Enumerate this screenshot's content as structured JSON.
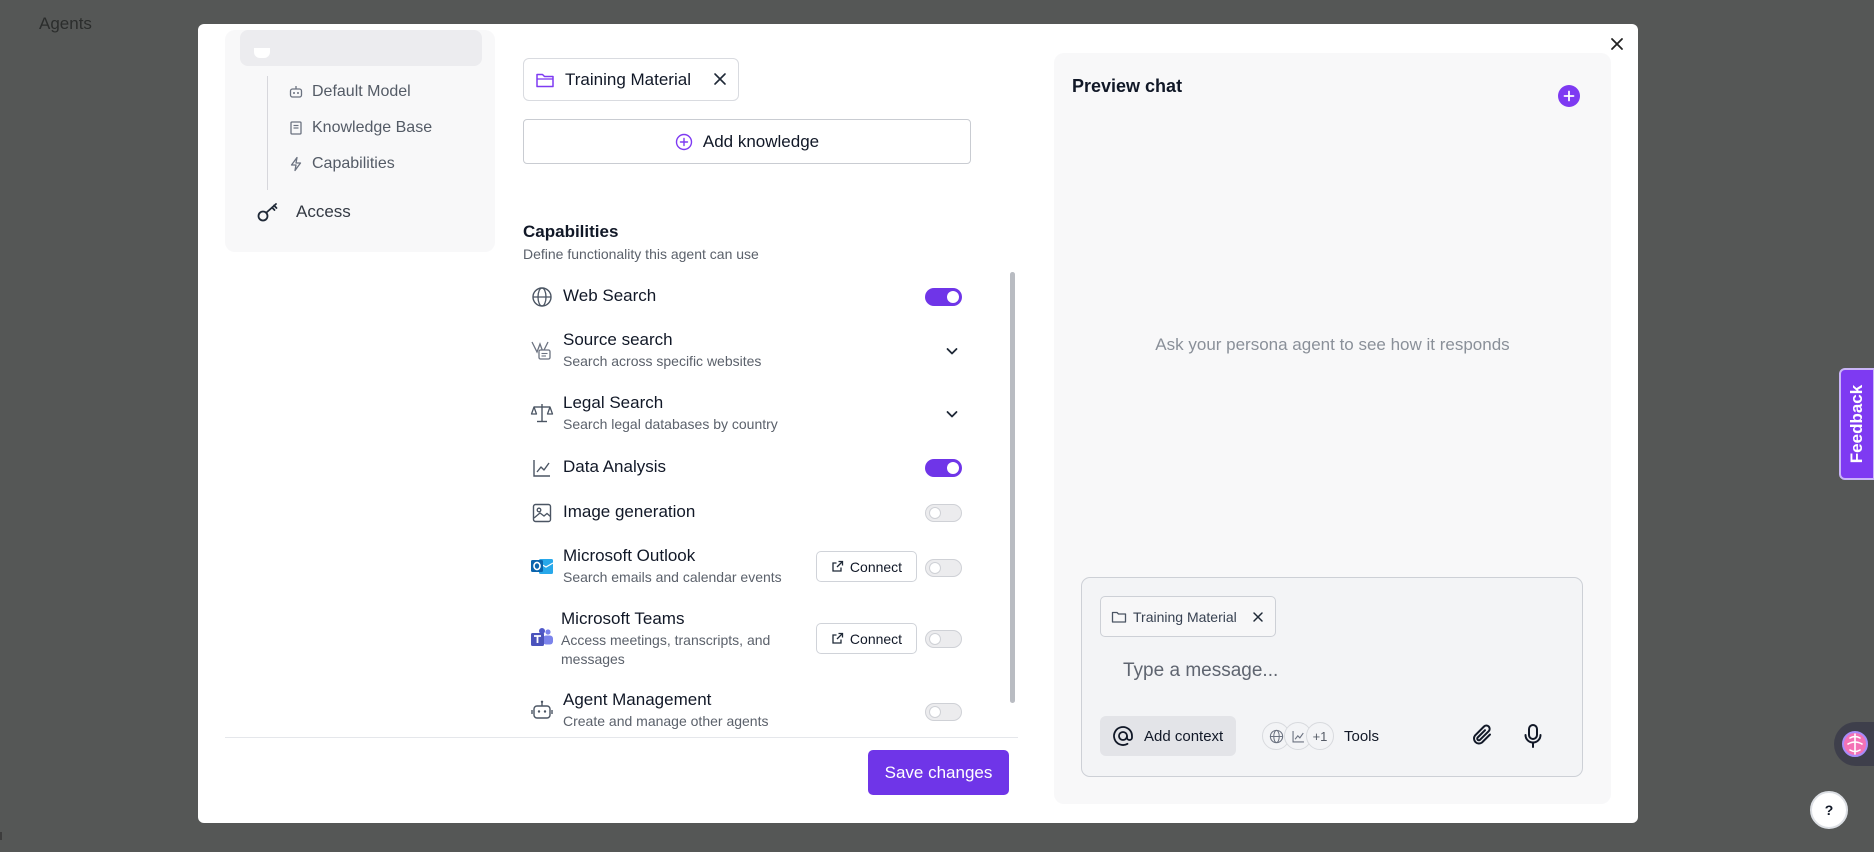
{
  "background": {
    "page_title": "Agents"
  },
  "nav": {
    "sub_items": [
      {
        "label": "Default Model",
        "icon": "bot-icon"
      },
      {
        "label": "Knowledge Base",
        "icon": "book-icon"
      },
      {
        "label": "Capabilities",
        "icon": "bolt-icon"
      }
    ],
    "access_label": "Access",
    "access_icon": "key-icon"
  },
  "knowledge": {
    "chip_label": "Training Material",
    "add_button_label": "Add knowledge"
  },
  "capabilities": {
    "title": "Capabilities",
    "description": "Define functionality this agent can use",
    "items": [
      {
        "name": "Web Search",
        "subtitle": "",
        "icon": "globe-icon",
        "control": "toggle",
        "enabled": true
      },
      {
        "name": "Source search",
        "subtitle": "Search across specific websites",
        "icon": "source-search-icon",
        "control": "expand",
        "enabled": false
      },
      {
        "name": "Legal Search",
        "subtitle": "Search legal databases by country",
        "icon": "scales-icon",
        "control": "expand",
        "enabled": false
      },
      {
        "name": "Data Analysis",
        "subtitle": "",
        "icon": "chart-line-icon",
        "control": "toggle",
        "enabled": true
      },
      {
        "name": "Image generation",
        "subtitle": "",
        "icon": "image-icon",
        "control": "toggle",
        "enabled": false
      },
      {
        "name": "Microsoft Outlook",
        "subtitle": "Search emails and calendar events",
        "icon": "outlook-icon",
        "control": "connect",
        "enabled": false
      },
      {
        "name": "Microsoft Teams",
        "subtitle": "Access meetings, transcripts, and messages",
        "icon": "teams-icon",
        "control": "connect",
        "enabled": false
      },
      {
        "name": "Agent Management",
        "subtitle": "Create and manage other agents",
        "icon": "robot-icon",
        "control": "toggle",
        "enabled": false
      }
    ],
    "connect_label": "Connect"
  },
  "footer": {
    "save_label": "Save changes"
  },
  "preview": {
    "title": "Preview chat",
    "hint": "Ask your persona agent to see how it responds",
    "chip_label": "Training Material",
    "input_placeholder": "Type a message...",
    "add_context_label": "Add context",
    "tools_extra_count": "+1",
    "tools_label": "Tools"
  },
  "widgets": {
    "feedback_label": "Feedback",
    "help_label": "?"
  },
  "colors": {
    "accent": "#6f35e8",
    "backdrop": "#555756"
  }
}
